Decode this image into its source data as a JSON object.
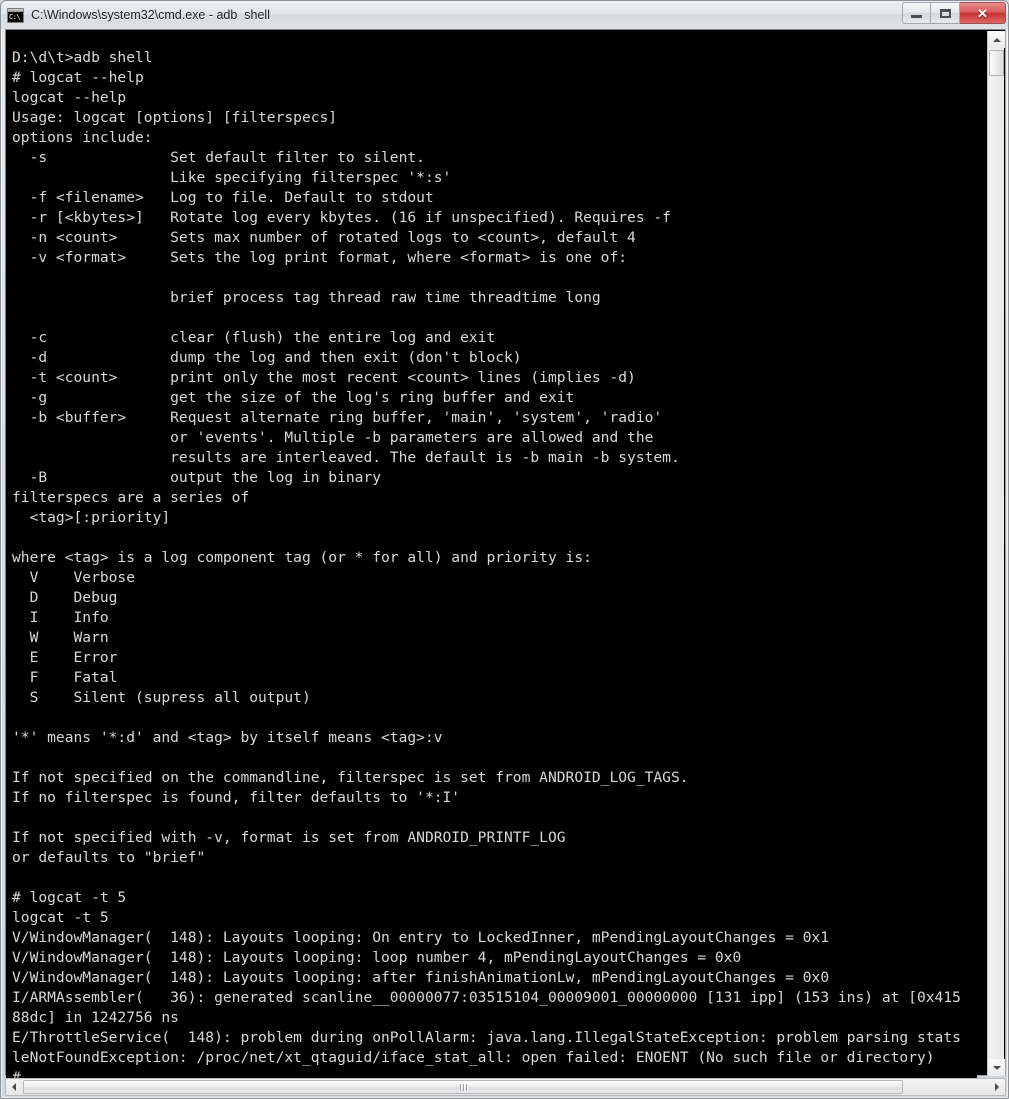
{
  "window": {
    "title": "C:\\Windows\\system32\\cmd.exe - adb  shell",
    "icon": "cmd-console-icon",
    "colors": {
      "console_background": "#000000",
      "console_foreground": "#d8d8d8",
      "close_button": "#c43333",
      "titlebar": "#e3e6e9"
    },
    "caption_buttons": {
      "minimize_label": "–",
      "maximize_label": "□",
      "close_label": "✕"
    }
  },
  "scrollbars": {
    "vertical": {
      "up_arrow": "▲",
      "down_arrow": "▼",
      "thumb_position_percent": 2
    },
    "horizontal": {
      "left_arrow": "◀",
      "right_arrow": "▶",
      "thumb_position_percent": 0
    }
  },
  "console": {
    "lines": [
      "D:\\d\\t>adb shell",
      "# logcat --help",
      "logcat --help",
      "Usage: logcat [options] [filterspecs]",
      "options include:",
      "  -s              Set default filter to silent.",
      "                  Like specifying filterspec '*:s'",
      "  -f <filename>   Log to file. Default to stdout",
      "  -r [<kbytes>]   Rotate log every kbytes. (16 if unspecified). Requires -f",
      "  -n <count>      Sets max number of rotated logs to <count>, default 4",
      "  -v <format>     Sets the log print format, where <format> is one of:",
      "",
      "                  brief process tag thread raw time threadtime long",
      "",
      "  -c              clear (flush) the entire log and exit",
      "  -d              dump the log and then exit (don't block)",
      "  -t <count>      print only the most recent <count> lines (implies -d)",
      "  -g              get the size of the log's ring buffer and exit",
      "  -b <buffer>     Request alternate ring buffer, 'main', 'system', 'radio'",
      "                  or 'events'. Multiple -b parameters are allowed and the",
      "                  results are interleaved. The default is -b main -b system.",
      "  -B              output the log in binary",
      "filterspecs are a series of",
      "  <tag>[:priority]",
      "",
      "where <tag> is a log component tag (or * for all) and priority is:",
      "  V    Verbose",
      "  D    Debug",
      "  I    Info",
      "  W    Warn",
      "  E    Error",
      "  F    Fatal",
      "  S    Silent (supress all output)",
      "",
      "'*' means '*:d' and <tag> by itself means <tag>:v",
      "",
      "If not specified on the commandline, filterspec is set from ANDROID_LOG_TAGS.",
      "If no filterspec is found, filter defaults to '*:I'",
      "",
      "If not specified with -v, format is set from ANDROID_PRINTF_LOG",
      "or defaults to \"brief\"",
      "",
      "# logcat -t 5",
      "logcat -t 5",
      "V/WindowManager(  148): Layouts looping: On entry to LockedInner, mPendingLayoutChanges = 0x1",
      "V/WindowManager(  148): Layouts looping: loop number 4, mPendingLayoutChanges = 0x0",
      "V/WindowManager(  148): Layouts looping: after finishAnimationLw, mPendingLayoutChanges = 0x0",
      "I/ARMAssembler(   36): generated scanline__00000077:03515104_00009001_00000000 [131 ipp] (153 ins) at [0x415",
      "88dc] in 1242756 ns",
      "E/ThrottleService(  148): problem during onPollAlarm: java.lang.IllegalStateException: problem parsing stats",
      "leNotFoundException: /proc/net/xt_qtaguid/iface_stat_all: open failed: ENOENT (No such file or directory)",
      "#"
    ]
  }
}
